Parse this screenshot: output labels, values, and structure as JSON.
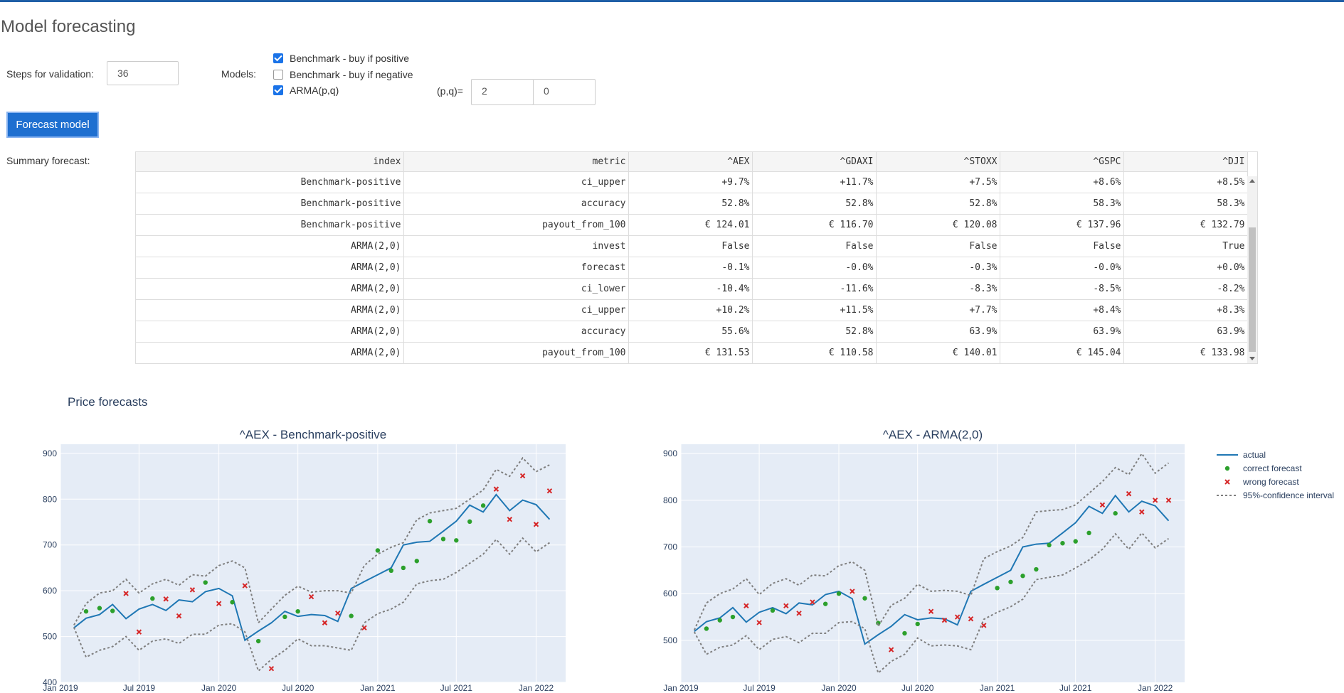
{
  "page": {
    "title": "Model forecasting"
  },
  "controls": {
    "steps_label": "Steps for validation:",
    "steps_value": "36",
    "models_label": "Models:",
    "models": [
      {
        "label": "Benchmark - buy if positive",
        "checked": true
      },
      {
        "label": "Benchmark - buy if negative",
        "checked": false
      },
      {
        "label": "ARMA(p,q)",
        "checked": true
      }
    ],
    "pq_label": "(p,q)=",
    "p_value": "2",
    "q_value": "0",
    "forecast_button": "Forecast model"
  },
  "summary": {
    "label": "Summary forecast:",
    "columns": [
      "index",
      "metric",
      "^AEX",
      "^GDAXI",
      "^STOXX",
      "^GSPC",
      "^DJI"
    ],
    "rows": [
      [
        "Benchmark-positive",
        "ci_upper",
        "+9.7%",
        "+11.7%",
        "+7.5%",
        "+8.6%",
        "+8.5%"
      ],
      [
        "Benchmark-positive",
        "accuracy",
        "52.8%",
        "52.8%",
        "52.8%",
        "58.3%",
        "58.3%"
      ],
      [
        "Benchmark-positive",
        "payout_from_100",
        "€ 124.01",
        "€ 116.70",
        "€ 120.08",
        "€ 137.96",
        "€ 132.79"
      ],
      [
        "ARMA(2,0)",
        "invest",
        "False",
        "False",
        "False",
        "False",
        "True"
      ],
      [
        "ARMA(2,0)",
        "forecast",
        "-0.1%",
        "-0.0%",
        "-0.3%",
        "-0.0%",
        "+0.0%"
      ],
      [
        "ARMA(2,0)",
        "ci_lower",
        "-10.4%",
        "-11.6%",
        "-8.3%",
        "-8.5%",
        "-8.2%"
      ],
      [
        "ARMA(2,0)",
        "ci_upper",
        "+10.2%",
        "+11.5%",
        "+7.7%",
        "+8.4%",
        "+8.3%"
      ],
      [
        "ARMA(2,0)",
        "accuracy",
        "55.6%",
        "52.8%",
        "63.9%",
        "63.9%",
        "63.9%"
      ],
      [
        "ARMA(2,0)",
        "payout_from_100",
        "€ 131.53",
        "€ 110.58",
        "€ 140.01",
        "€ 145.04",
        "€ 133.98"
      ]
    ]
  },
  "section_title": "Price forecasts",
  "legend": {
    "items": [
      {
        "label": "actual",
        "kind": "line",
        "color": "#1f77b4"
      },
      {
        "label": "correct forecast",
        "kind": "dot",
        "color": "#2ca02c"
      },
      {
        "label": "wrong forecast",
        "kind": "x",
        "color": "#d62728"
      },
      {
        "label": "95%-confidence interval",
        "kind": "dash",
        "color": "#7f7f7f"
      }
    ]
  },
  "chart_data": [
    {
      "type": "line",
      "title": "^AEX - Benchmark-positive",
      "xlabel": "",
      "ylabel": "",
      "x_ticks": [
        "Jan 2019",
        "Jul 2019",
        "Jan 2020",
        "Jul 2020",
        "Jan 2021",
        "Jul 2021",
        "Jan 2022"
      ],
      "y_ticks": [
        400,
        500,
        600,
        700,
        800,
        900
      ],
      "ylim": [
        400,
        920
      ],
      "xlim": [
        "2019-01-01",
        "2022-03-10"
      ],
      "grid": true,
      "series": [
        {
          "name": "actual",
          "x": [
            "2019-02-01",
            "2019-03-01",
            "2019-04-01",
            "2019-05-01",
            "2019-06-01",
            "2019-07-01",
            "2019-08-01",
            "2019-09-01",
            "2019-10-01",
            "2019-11-01",
            "2019-12-01",
            "2020-01-01",
            "2020-02-01",
            "2020-03-01",
            "2020-04-01",
            "2020-05-01",
            "2020-06-01",
            "2020-07-01",
            "2020-08-01",
            "2020-09-01",
            "2020-10-01",
            "2020-11-01",
            "2020-12-01",
            "2021-01-01",
            "2021-02-01",
            "2021-03-01",
            "2021-04-01",
            "2021-05-01",
            "2021-06-01",
            "2021-07-01",
            "2021-08-01",
            "2021-09-01",
            "2021-10-01",
            "2021-11-01",
            "2021-12-01",
            "2022-01-01",
            "2022-02-01"
          ],
          "values": [
            519,
            540,
            548,
            570,
            539,
            560,
            570,
            557,
            580,
            576,
            598,
            605,
            589,
            492,
            512,
            530,
            555,
            544,
            548,
            546,
            533,
            605,
            620,
            635,
            650,
            700,
            706,
            708,
            730,
            752,
            787,
            772,
            810,
            775,
            798,
            788,
            756
          ]
        },
        {
          "name": "correct forecast",
          "x": [
            "2019-03-01",
            "2019-04-01",
            "2019-05-01",
            "2019-08-01",
            "2019-12-01",
            "2020-02-01",
            "2020-04-01",
            "2020-06-01",
            "2020-07-01",
            "2020-11-01",
            "2021-01-01",
            "2021-02-01",
            "2021-03-01",
            "2021-04-01",
            "2021-05-01",
            "2021-06-01",
            "2021-07-01",
            "2021-08-01",
            "2021-09-01"
          ],
          "values": [
            555,
            562,
            556,
            583,
            618,
            575,
            490,
            543,
            555,
            545,
            688,
            644,
            650,
            665,
            752,
            713,
            710,
            751,
            786
          ]
        },
        {
          "name": "wrong forecast",
          "x": [
            "2019-06-01",
            "2019-07-01",
            "2019-09-01",
            "2019-10-01",
            "2019-11-01",
            "2020-01-01",
            "2020-03-01",
            "2020-05-01",
            "2020-08-01",
            "2020-09-01",
            "2020-10-01",
            "2020-12-01",
            "2021-10-01",
            "2021-11-01",
            "2021-12-01",
            "2022-01-01",
            "2022-02-01"
          ],
          "values": [
            594,
            510,
            582,
            545,
            602,
            572,
            611,
            430,
            587,
            530,
            551,
            519,
            822,
            756,
            851,
            745,
            818
          ]
        },
        {
          "name": "95%-confidence interval upper",
          "x": [
            "2019-02-01",
            "2019-03-01",
            "2019-04-01",
            "2019-05-01",
            "2019-06-01",
            "2019-07-01",
            "2019-08-01",
            "2019-09-01",
            "2019-10-01",
            "2019-11-01",
            "2019-12-01",
            "2020-01-01",
            "2020-02-01",
            "2020-03-01",
            "2020-04-01",
            "2020-05-01",
            "2020-06-01",
            "2020-07-01",
            "2020-08-01",
            "2020-09-01",
            "2020-10-01",
            "2020-11-01",
            "2020-12-01",
            "2021-01-01",
            "2021-02-01",
            "2021-03-01",
            "2021-04-01",
            "2021-05-01",
            "2021-06-01",
            "2021-07-01",
            "2021-08-01",
            "2021-09-01",
            "2021-10-01",
            "2021-11-01",
            "2021-12-01",
            "2022-01-01",
            "2022-02-01"
          ],
          "values": [
            525,
            572,
            595,
            600,
            625,
            595,
            615,
            625,
            612,
            635,
            632,
            655,
            665,
            650,
            530,
            560,
            590,
            610,
            597,
            600,
            600,
            595,
            655,
            680,
            695,
            705,
            755,
            770,
            775,
            780,
            800,
            820,
            865,
            850,
            890,
            860,
            875
          ]
        },
        {
          "name": "95%-confidence interval lower",
          "x": [
            "2019-02-01",
            "2019-03-01",
            "2019-04-01",
            "2019-05-01",
            "2019-06-01",
            "2019-07-01",
            "2019-08-01",
            "2019-09-01",
            "2019-10-01",
            "2019-11-01",
            "2019-12-01",
            "2020-01-01",
            "2020-02-01",
            "2020-03-01",
            "2020-04-01",
            "2020-05-01",
            "2020-06-01",
            "2020-07-01",
            "2020-08-01",
            "2020-09-01",
            "2020-10-01",
            "2020-11-01",
            "2020-12-01",
            "2021-01-01",
            "2021-02-01",
            "2021-03-01",
            "2021-04-01",
            "2021-05-01",
            "2021-06-01",
            "2021-07-01",
            "2021-08-01",
            "2021-09-01",
            "2021-10-01",
            "2021-11-01",
            "2021-12-01",
            "2022-01-01",
            "2022-02-01"
          ],
          "values": [
            520,
            455,
            470,
            478,
            500,
            470,
            490,
            495,
            485,
            505,
            505,
            525,
            528,
            510,
            425,
            450,
            470,
            495,
            480,
            480,
            475,
            470,
            530,
            550,
            560,
            575,
            615,
            622,
            625,
            640,
            660,
            680,
            712,
            680,
            715,
            685,
            705
          ]
        }
      ]
    },
    {
      "type": "line",
      "title": "^AEX - ARMA(2,0)",
      "xlabel": "",
      "ylabel": "",
      "x_ticks": [
        "Jan 2019",
        "Jul 2019",
        "Jan 2020",
        "Jul 2020",
        "Jan 2021",
        "Jul 2021",
        "Jan 2022"
      ],
      "y_ticks": [
        500,
        600,
        700,
        800,
        900
      ],
      "ylim": [
        410,
        920
      ],
      "xlim": [
        "2019-01-01",
        "2022-03-10"
      ],
      "grid": true,
      "series": [
        {
          "name": "actual",
          "x": [
            "2019-02-01",
            "2019-03-01",
            "2019-04-01",
            "2019-05-01",
            "2019-06-01",
            "2019-07-01",
            "2019-08-01",
            "2019-09-01",
            "2019-10-01",
            "2019-11-01",
            "2019-12-01",
            "2020-01-01",
            "2020-02-01",
            "2020-03-01",
            "2020-04-01",
            "2020-05-01",
            "2020-06-01",
            "2020-07-01",
            "2020-08-01",
            "2020-09-01",
            "2020-10-01",
            "2020-11-01",
            "2020-12-01",
            "2021-01-01",
            "2021-02-01",
            "2021-03-01",
            "2021-04-01",
            "2021-05-01",
            "2021-06-01",
            "2021-07-01",
            "2021-08-01",
            "2021-09-01",
            "2021-10-01",
            "2021-11-01",
            "2021-12-01",
            "2022-01-01",
            "2022-02-01"
          ],
          "values": [
            519,
            540,
            548,
            570,
            539,
            560,
            570,
            557,
            580,
            576,
            598,
            605,
            589,
            492,
            512,
            530,
            555,
            544,
            548,
            546,
            533,
            605,
            620,
            635,
            650,
            700,
            706,
            708,
            730,
            752,
            787,
            772,
            810,
            775,
            798,
            788,
            756
          ]
        },
        {
          "name": "correct forecast",
          "x": [
            "2019-03-01",
            "2019-04-01",
            "2019-05-01",
            "2019-08-01",
            "2019-12-01",
            "2020-01-01",
            "2020-03-01",
            "2020-04-01",
            "2020-06-01",
            "2020-07-01",
            "2021-01-01",
            "2021-02-01",
            "2021-03-01",
            "2021-04-01",
            "2021-05-01",
            "2021-06-01",
            "2021-07-01",
            "2021-08-01",
            "2021-10-01"
          ],
          "values": [
            525,
            543,
            550,
            564,
            578,
            600,
            590,
            537,
            515,
            535,
            612,
            625,
            638,
            652,
            704,
            708,
            712,
            730,
            772
          ]
        },
        {
          "name": "wrong forecast",
          "x": [
            "2019-06-01",
            "2019-07-01",
            "2019-09-01",
            "2019-10-01",
            "2019-11-01",
            "2020-02-01",
            "2020-05-01",
            "2020-08-01",
            "2020-09-01",
            "2020-10-01",
            "2020-11-01",
            "2020-12-01",
            "2021-09-01",
            "2021-11-01",
            "2021-12-01",
            "2022-01-01",
            "2022-02-01"
          ],
          "values": [
            574,
            538,
            574,
            558,
            582,
            605,
            480,
            562,
            543,
            550,
            546,
            532,
            790,
            814,
            775,
            800,
            800
          ]
        },
        {
          "name": "95%-confidence interval upper",
          "x": [
            "2019-02-01",
            "2019-03-01",
            "2019-04-01",
            "2019-05-01",
            "2019-06-01",
            "2019-07-01",
            "2019-08-01",
            "2019-09-01",
            "2019-10-01",
            "2019-11-01",
            "2019-12-01",
            "2020-01-01",
            "2020-02-01",
            "2020-03-01",
            "2020-04-01",
            "2020-05-01",
            "2020-06-01",
            "2020-07-01",
            "2020-08-01",
            "2020-09-01",
            "2020-10-01",
            "2020-11-01",
            "2020-12-01",
            "2021-01-01",
            "2021-02-01",
            "2021-03-01",
            "2021-04-01",
            "2021-05-01",
            "2021-06-01",
            "2021-07-01",
            "2021-08-01",
            "2021-09-01",
            "2021-10-01",
            "2021-11-01",
            "2021-12-01",
            "2022-01-01",
            "2022-02-01"
          ],
          "values": [
            522,
            580,
            600,
            610,
            632,
            598,
            622,
            632,
            618,
            640,
            638,
            660,
            668,
            650,
            530,
            575,
            590,
            620,
            605,
            607,
            605,
            596,
            675,
            690,
            702,
            720,
            775,
            778,
            780,
            790,
            815,
            840,
            870,
            855,
            900,
            858,
            880
          ]
        },
        {
          "name": "95%-confidence interval lower",
          "x": [
            "2019-02-01",
            "2019-03-01",
            "2019-04-01",
            "2019-05-01",
            "2019-06-01",
            "2019-07-01",
            "2019-08-01",
            "2019-09-01",
            "2019-10-01",
            "2019-11-01",
            "2019-12-01",
            "2020-01-01",
            "2020-02-01",
            "2020-03-01",
            "2020-04-01",
            "2020-05-01",
            "2020-06-01",
            "2020-07-01",
            "2020-08-01",
            "2020-09-01",
            "2020-10-01",
            "2020-11-01",
            "2020-12-01",
            "2021-01-01",
            "2021-02-01",
            "2021-03-01",
            "2021-04-01",
            "2021-05-01",
            "2021-06-01",
            "2021-07-01",
            "2021-08-01",
            "2021-09-01",
            "2021-10-01",
            "2021-11-01",
            "2021-12-01",
            "2022-01-01",
            "2022-02-01"
          ],
          "values": [
            518,
            470,
            485,
            490,
            510,
            480,
            502,
            508,
            495,
            515,
            515,
            538,
            540,
            525,
            430,
            455,
            470,
            505,
            488,
            490,
            488,
            480,
            545,
            560,
            572,
            588,
            630,
            635,
            640,
            655,
            672,
            695,
            728,
            695,
            730,
            698,
            718
          ]
        }
      ]
    }
  ]
}
